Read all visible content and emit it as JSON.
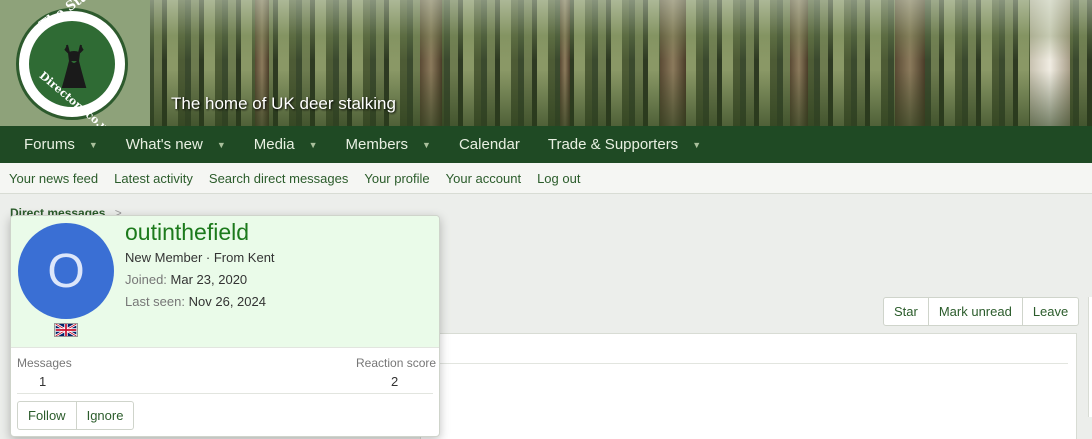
{
  "header": {
    "logo_top_text": "The Stalking",
    "logo_bottom_text": "Directory.co.uk",
    "tagline": "The home of UK deer stalking"
  },
  "nav": {
    "items": [
      {
        "label": "Forums",
        "dropdown": true
      },
      {
        "label": "What's new",
        "dropdown": true
      },
      {
        "label": "Media",
        "dropdown": true
      },
      {
        "label": "Members",
        "dropdown": true
      },
      {
        "label": "Calendar",
        "dropdown": false
      },
      {
        "label": "Trade & Supporters",
        "dropdown": true
      }
    ]
  },
  "subnav": {
    "items": [
      "Your news feed",
      "Latest activity",
      "Search direct messages",
      "Your profile",
      "Your account",
      "Log out"
    ]
  },
  "breadcrumb": {
    "label": "Direct messages",
    "separator": ">"
  },
  "conversation_actions": {
    "star": "Star",
    "mark_unread": "Mark unread",
    "leave": "Leave"
  },
  "member_card": {
    "avatar_letter": "O",
    "username": "outinthefield",
    "title": "New Member · From Kent",
    "joined_label": "Joined:",
    "joined_value": "Mar 23, 2020",
    "last_seen_label": "Last seen:",
    "last_seen_value": "Nov 26, 2024",
    "flag": "uk-flag",
    "messages_label": "Messages",
    "messages_value": "1",
    "reaction_label": "Reaction score",
    "reaction_value": "2",
    "follow_label": "Follow",
    "ignore_label": "Ignore"
  },
  "colors": {
    "nav_bg": "#1f4a24",
    "link_green": "#2b5c2b",
    "username_green": "#1c7a1c",
    "avatar_blue": "#3a6fd4",
    "card_top_bg": "#eafbe9"
  }
}
